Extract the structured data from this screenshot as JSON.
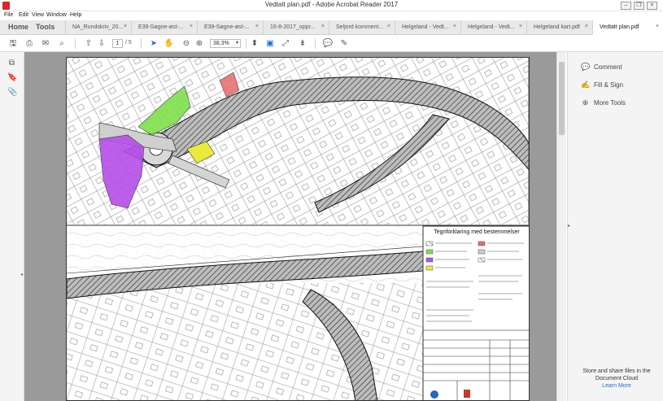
{
  "window": {
    "title": "Vedtatt plan.pdf - Adobe Acrobat Reader 2017"
  },
  "menu": [
    "File",
    "Edit",
    "View",
    "Window",
    "Help"
  ],
  "nav_tabs": [
    "Home",
    "Tools"
  ],
  "doc_tabs": [
    {
      "label": "NA_Rundskriv_20...",
      "active": false
    },
    {
      "label": "E39-Søgne-øst-...",
      "active": false
    },
    {
      "label": "E39-Søgne-øst-...",
      "active": false
    },
    {
      "label": "16-8-2017_oppr...",
      "active": false
    },
    {
      "label": "Seljord komment...",
      "active": false
    },
    {
      "label": "Helgeland - Vedt...",
      "active": false
    },
    {
      "label": "Helgeland - Vedt...",
      "active": false
    },
    {
      "label": "Helgeland kart.pdf",
      "active": false
    },
    {
      "label": "Vedtatt plan.pdf",
      "active": true
    }
  ],
  "toolbar": {
    "page_current": "1",
    "page_total": "/ 5",
    "zoom": "38,3%"
  },
  "right_panel": {
    "comment": "Comment",
    "fill_sign": "Fill & Sign",
    "more_tools": "More Tools",
    "cloud_text": "Store and share files in the Document Cloud",
    "learn_more": "Learn More"
  },
  "map": {
    "legend_title": "Tegnforklaring med bestemmelser"
  },
  "colors": {
    "accent": "#1d6fd8",
    "pdf_red": "#d7262d",
    "green_zone": "#7fe04a",
    "purple_zone": "#b54ee8",
    "yellow_zone": "#eaea3c",
    "red_zone": "#e86a6a"
  }
}
